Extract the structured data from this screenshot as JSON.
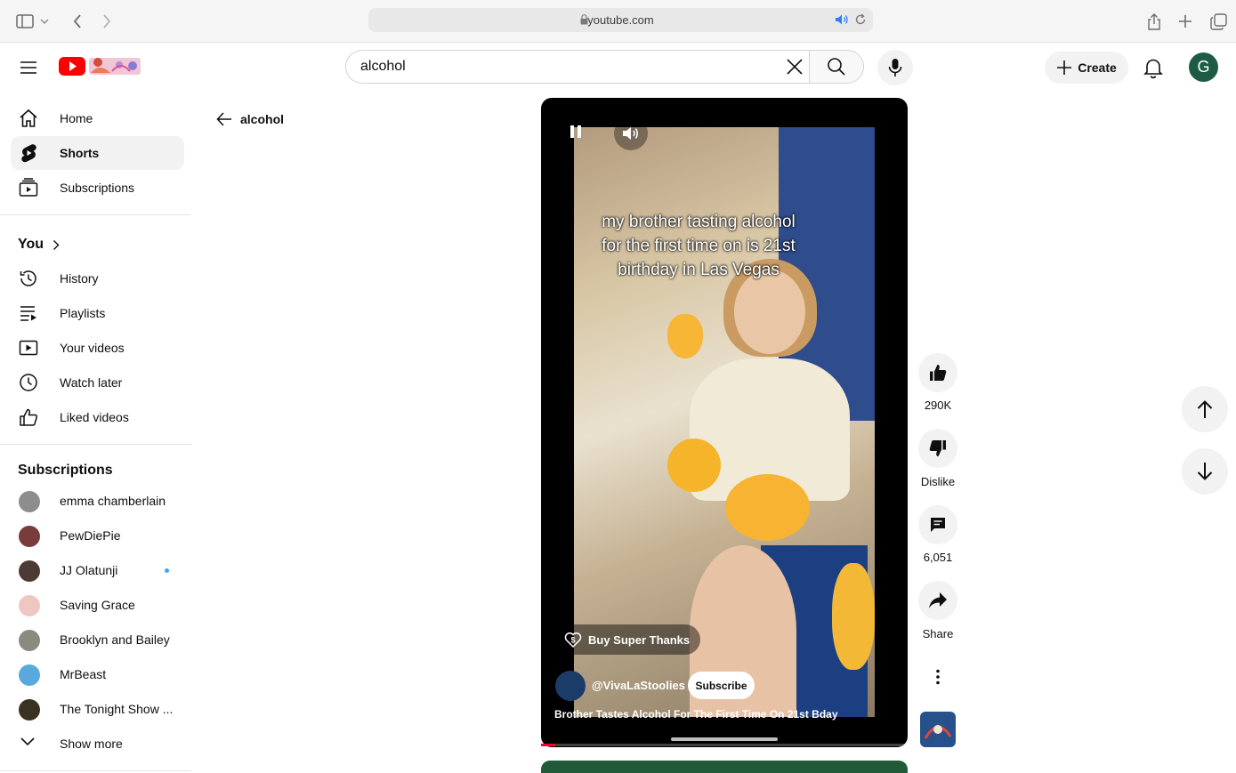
{
  "browser": {
    "url": "youtube.com"
  },
  "header": {
    "search_value": "alcohol",
    "create_label": "Create",
    "avatar_letter": "G"
  },
  "sidebar": {
    "main": [
      {
        "label": "Home",
        "icon": "home-icon"
      },
      {
        "label": "Shorts",
        "icon": "shorts-icon",
        "active": true
      },
      {
        "label": "Subscriptions",
        "icon": "subscriptions-icon"
      }
    ],
    "you_title": "You",
    "you_items": [
      {
        "label": "History",
        "icon": "history-icon"
      },
      {
        "label": "Playlists",
        "icon": "playlists-icon"
      },
      {
        "label": "Your videos",
        "icon": "your-videos-icon"
      },
      {
        "label": "Watch later",
        "icon": "watch-later-icon"
      },
      {
        "label": "Liked videos",
        "icon": "liked-videos-icon"
      }
    ],
    "subscriptions_title": "Subscriptions",
    "subscriptions": [
      {
        "label": "emma chamberlain",
        "color": "#8d8d8d"
      },
      {
        "label": "PewDiePie",
        "color": "#7a3b3b"
      },
      {
        "label": "JJ Olatunji",
        "color": "#4b3b34",
        "new": true
      },
      {
        "label": "Saving Grace",
        "color": "#f0c6c0"
      },
      {
        "label": "Brooklyn and Bailey",
        "color": "#8c8a7f"
      },
      {
        "label": "MrBeast",
        "color": "#5aa9dd"
      },
      {
        "label": "The Tonight Show ...",
        "color": "#3a3120"
      }
    ],
    "show_more": "Show more"
  },
  "main": {
    "back_label": "alcohol"
  },
  "short": {
    "caption_lines": [
      "my brother tasting alcohol",
      "for the first time on is 21st",
      "birthday in Las Vegas"
    ],
    "super_thanks": "Buy Super Thanks",
    "channel": "@VivaLaStoolies",
    "subscribe": "Subscribe",
    "title": "Brother Tastes Alcohol For The First Time On 21st Bday",
    "progress": 0.04,
    "likes": "290K",
    "dislike": "Dislike",
    "comments": "6,051",
    "share": "Share"
  },
  "colors": {
    "youtube_red": "#ff0000",
    "active_bg": "#f2f2f2",
    "avatar": "#1e5b45"
  }
}
